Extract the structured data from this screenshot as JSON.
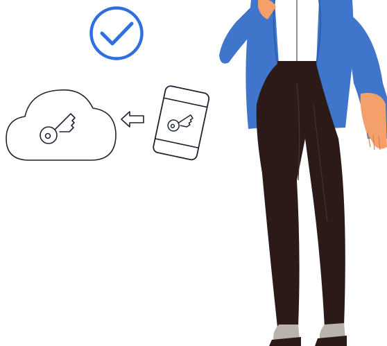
{
  "illustration": {
    "icons": [
      "check-circle-icon",
      "cloud-key-icon",
      "arrow-left-icon",
      "phone-key-icon"
    ],
    "colors": {
      "accent_blue": "#2f6fe0",
      "jacket_blue": "#3f76cc",
      "skin": "#f4a06a",
      "pants": "#2b1a17",
      "line": "#1c2430",
      "shoe": "#b9b3ac"
    }
  }
}
